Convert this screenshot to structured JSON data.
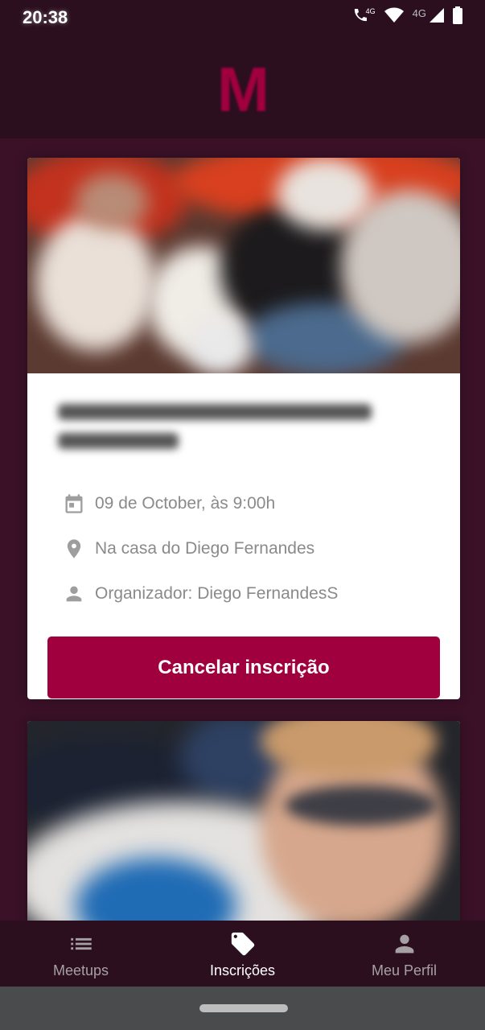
{
  "status_bar": {
    "time": "20:38",
    "icons": [
      "phone-4g-icon",
      "wifi-icon",
      "signal-4g-icon",
      "battery-icon"
    ],
    "network_label_1": "4G",
    "network_label_2": "4G"
  },
  "header": {
    "logo_text": "M",
    "logo_color": "#a1003f"
  },
  "feed": {
    "cards": [
      {
        "date_text": "09 de October, às 9:00h",
        "location_text": "Na casa do Diego Fernandes",
        "organizer_text": "Organizador: Diego FernandesS",
        "action_label": "Cancelar inscrição",
        "icons": [
          "calendar-icon",
          "location-pin-icon",
          "person-icon"
        ]
      }
    ]
  },
  "bottom_nav": {
    "items": [
      {
        "label": "Meetups",
        "icon": "list-icon",
        "active": false
      },
      {
        "label": "Inscrições",
        "icon": "tag-icon",
        "active": true
      },
      {
        "label": "Meu Perfil",
        "icon": "person-icon",
        "active": false
      }
    ]
  },
  "colors": {
    "background": "#3a1127",
    "header": "#2b0f1f",
    "accent": "#a0003d",
    "inactive_nav": "#a6a0a4",
    "active_nav": "#ffffff"
  }
}
